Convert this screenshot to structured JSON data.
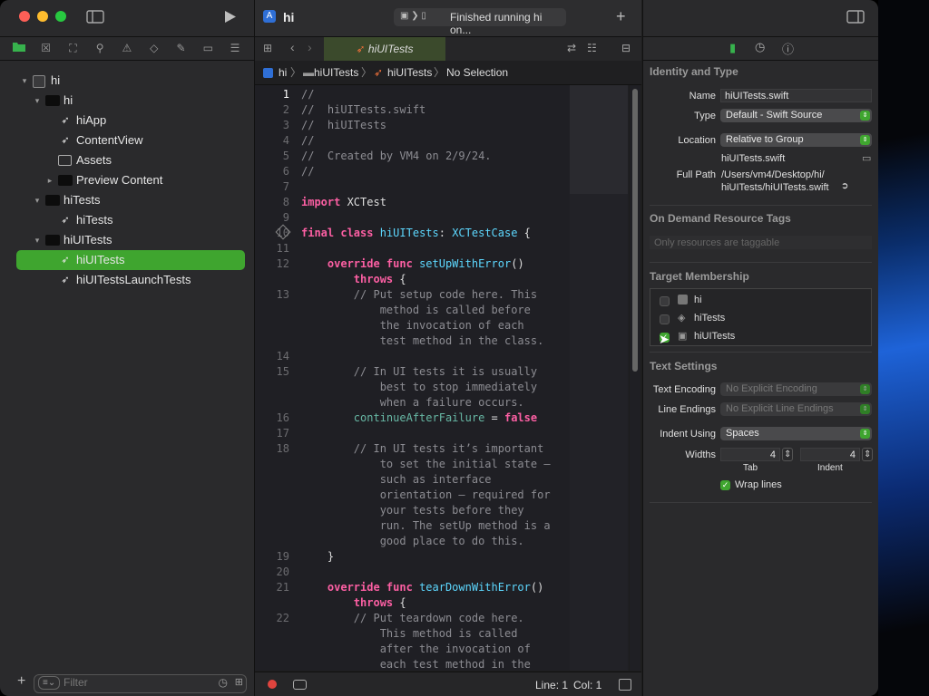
{
  "window": {
    "project_title": "hi",
    "status_text": "Finished running hi on...",
    "add_icon": "plus-icon",
    "run_icon": "play-icon"
  },
  "navigator": {
    "icons": [
      "folder-icon",
      "source-control-icon",
      "symbol-icon",
      "search-icon",
      "issue-icon",
      "test-icon",
      "debug-icon",
      "breakpoint-icon",
      "report-icon"
    ],
    "tree": [
      {
        "label": "hi",
        "depth": 0,
        "kind": "project",
        "disclosure": "open"
      },
      {
        "label": "hi",
        "depth": 1,
        "kind": "folder",
        "disclosure": "open"
      },
      {
        "label": "hiApp",
        "depth": 2,
        "kind": "swift",
        "disclosure": ""
      },
      {
        "label": "ContentView",
        "depth": 2,
        "kind": "swift",
        "disclosure": ""
      },
      {
        "label": "Assets",
        "depth": 2,
        "kind": "assets",
        "disclosure": ""
      },
      {
        "label": "Preview Content",
        "depth": 2,
        "kind": "folder",
        "disclosure": "closed"
      },
      {
        "label": "hiTests",
        "depth": 1,
        "kind": "folder",
        "disclosure": "open"
      },
      {
        "label": "hiTests",
        "depth": 2,
        "kind": "swift",
        "disclosure": ""
      },
      {
        "label": "hiUITests",
        "depth": 1,
        "kind": "folder",
        "disclosure": "open"
      },
      {
        "label": "hiUITests",
        "depth": 2,
        "kind": "swift",
        "disclosure": "",
        "selected": true
      },
      {
        "label": "hiUITestsLaunchTests",
        "depth": 2,
        "kind": "swift",
        "disclosure": ""
      }
    ],
    "filter_placeholder": "Filter"
  },
  "editor": {
    "tab_label": "hiUITests",
    "jumpbar": [
      "hi",
      "hiUITests",
      "hiUITests",
      "No Selection"
    ],
    "lines": [
      {
        "n": "1",
        "html": "<span class=\"cm\">//</span>",
        "current": true
      },
      {
        "n": "2",
        "html": "<span class=\"cm\">//  hiUITests.swift</span>"
      },
      {
        "n": "3",
        "html": "<span class=\"cm\">//  hiUITests</span>"
      },
      {
        "n": "4",
        "html": "<span class=\"cm\">//</span>"
      },
      {
        "n": "5",
        "html": "<span class=\"cm\">//  Created by VM4 on 2/9/24.</span>"
      },
      {
        "n": "6",
        "html": "<span class=\"cm\">//</span>"
      },
      {
        "n": "7",
        "html": ""
      },
      {
        "n": "8",
        "html": "<span class=\"kw\">import</span> XCTest"
      },
      {
        "n": "9",
        "html": ""
      },
      {
        "n": "10",
        "html": "<span class=\"kw\">final class</span> <span class=\"ty\">hiUITests</span>: <span class=\"ty\">XCTestCase</span> {"
      },
      {
        "n": "11",
        "html": ""
      },
      {
        "n": "12",
        "html": "    <span class=\"kw\">override func</span> <span class=\"ty\">setUpWithError</span>()"
      },
      {
        "n": "",
        "html": "        <span class=\"kw\">throws</span> {"
      },
      {
        "n": "13",
        "html": "        <span class=\"cm\">// Put setup code here. This</span>"
      },
      {
        "n": "",
        "html": "            <span class=\"cm\">method is called before</span>"
      },
      {
        "n": "",
        "html": "            <span class=\"cm\">the invocation of each</span>"
      },
      {
        "n": "",
        "html": "            <span class=\"cm\">test method in the class.</span>"
      },
      {
        "n": "14",
        "html": ""
      },
      {
        "n": "15",
        "html": "        <span class=\"cm\">// In UI tests it is usually</span>"
      },
      {
        "n": "",
        "html": "            <span class=\"cm\">best to stop immediately</span>"
      },
      {
        "n": "",
        "html": "            <span class=\"cm\">when a failure occurs.</span>"
      },
      {
        "n": "16",
        "html": "        <span class=\"fn\">continueAfterFailure</span> = <span class=\"kw\">false</span>"
      },
      {
        "n": "17",
        "html": ""
      },
      {
        "n": "18",
        "html": "        <span class=\"cm\">// In UI tests it’s important</span>"
      },
      {
        "n": "",
        "html": "            <span class=\"cm\">to set the initial state –</span>"
      },
      {
        "n": "",
        "html": "            <span class=\"cm\">such as interface</span>"
      },
      {
        "n": "",
        "html": "            <span class=\"cm\">orientation – required for</span>"
      },
      {
        "n": "",
        "html": "            <span class=\"cm\">your tests before they</span>"
      },
      {
        "n": "",
        "html": "            <span class=\"cm\">run. The setUp method is a</span>"
      },
      {
        "n": "",
        "html": "            <span class=\"cm\">good place to do this.</span>"
      },
      {
        "n": "19",
        "html": "    }"
      },
      {
        "n": "20",
        "html": ""
      },
      {
        "n": "21",
        "html": "    <span class=\"kw\">override func</span> <span class=\"ty\">tearDownWithError</span>()"
      },
      {
        "n": "",
        "html": "        <span class=\"kw\">throws</span> {"
      },
      {
        "n": "22",
        "html": "        <span class=\"cm\">// Put teardown code here.</span>"
      },
      {
        "n": "",
        "html": "            <span class=\"cm\">This method is called</span>"
      },
      {
        "n": "",
        "html": "            <span class=\"cm\">after the invocation of</span>"
      },
      {
        "n": "",
        "html": "            <span class=\"cm\">each test method in the</span>"
      }
    ],
    "status": {
      "line": "Line: 1",
      "col": "Col: 1"
    }
  },
  "inspector": {
    "identity": {
      "header": "Identity and Type",
      "name_label": "Name",
      "name_value": "hiUITests.swift",
      "type_label": "Type",
      "type_value": "Default - Swift Source",
      "location_label": "Location",
      "location_value": "Relative to Group",
      "location_file": "hiUITests.swift",
      "fullpath_label": "Full Path",
      "fullpath_value_1": "/Users/vm4/Desktop/hi/",
      "fullpath_value_2": "hiUITests/hiUITests.swift"
    },
    "tags": {
      "header": "On Demand Resource Tags",
      "placeholder": "Only resources are taggable"
    },
    "membership": {
      "header": "Target Membership",
      "targets": [
        {
          "name": "hi",
          "checked": false
        },
        {
          "name": "hiTests",
          "checked": false
        },
        {
          "name": "hiUITests",
          "checked": true
        }
      ]
    },
    "text_settings": {
      "header": "Text Settings",
      "encoding_label": "Text Encoding",
      "encoding_value": "No Explicit Encoding",
      "endings_label": "Line Endings",
      "endings_value": "No Explicit Line Endings",
      "indent_label": "Indent Using",
      "indent_value": "Spaces",
      "widths_label": "Widths",
      "tab_value": "4",
      "tab_label": "Tab",
      "indent_width_value": "4",
      "indent_width_label": "Indent",
      "wrap_label": "Wrap lines",
      "wrap_checked": true
    }
  },
  "colors": {
    "accent": "#3fa52f",
    "keyword": "#fc5fa3",
    "type": "#5dd8ff",
    "comment": "#8c8c92"
  }
}
